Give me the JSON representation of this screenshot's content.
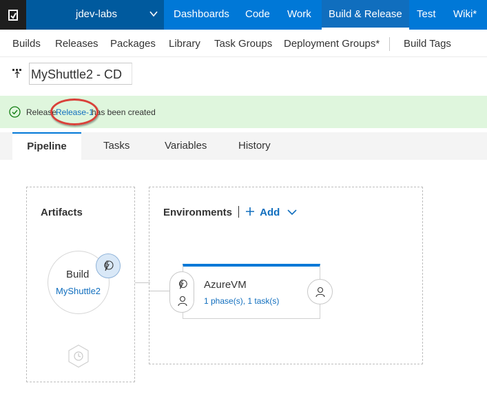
{
  "topnav": {
    "project": "jdev-labs",
    "items": [
      "Dashboards",
      "Code",
      "Work",
      "Build & Release",
      "Test",
      "Wiki*"
    ],
    "active": "Build & Release"
  },
  "subnav": {
    "items": [
      "Builds",
      "Releases",
      "Packages",
      "Library",
      "Task Groups",
      "Deployment Groups*",
      "Build Tags"
    ]
  },
  "page": {
    "title": "MyShuttle2 - CD"
  },
  "banner": {
    "prefix": "Release",
    "link": "Release-1",
    "suffix": "has been created",
    "status_color": "#107c10"
  },
  "tabs": [
    "Pipeline",
    "Tasks",
    "Variables",
    "History"
  ],
  "pipeline": {
    "artifacts": {
      "title": "Artifacts",
      "source_type": "Build",
      "source_name": "MyShuttle2"
    },
    "environments": {
      "title": "Environments",
      "add_label": "Add",
      "items": [
        {
          "name": "AzureVM",
          "summary": "1 phase(s), 1 task(s)"
        }
      ]
    }
  },
  "colors": {
    "accent": "#0078d7",
    "banner_bg": "#dff6dd",
    "annotation": "#d9413a"
  }
}
